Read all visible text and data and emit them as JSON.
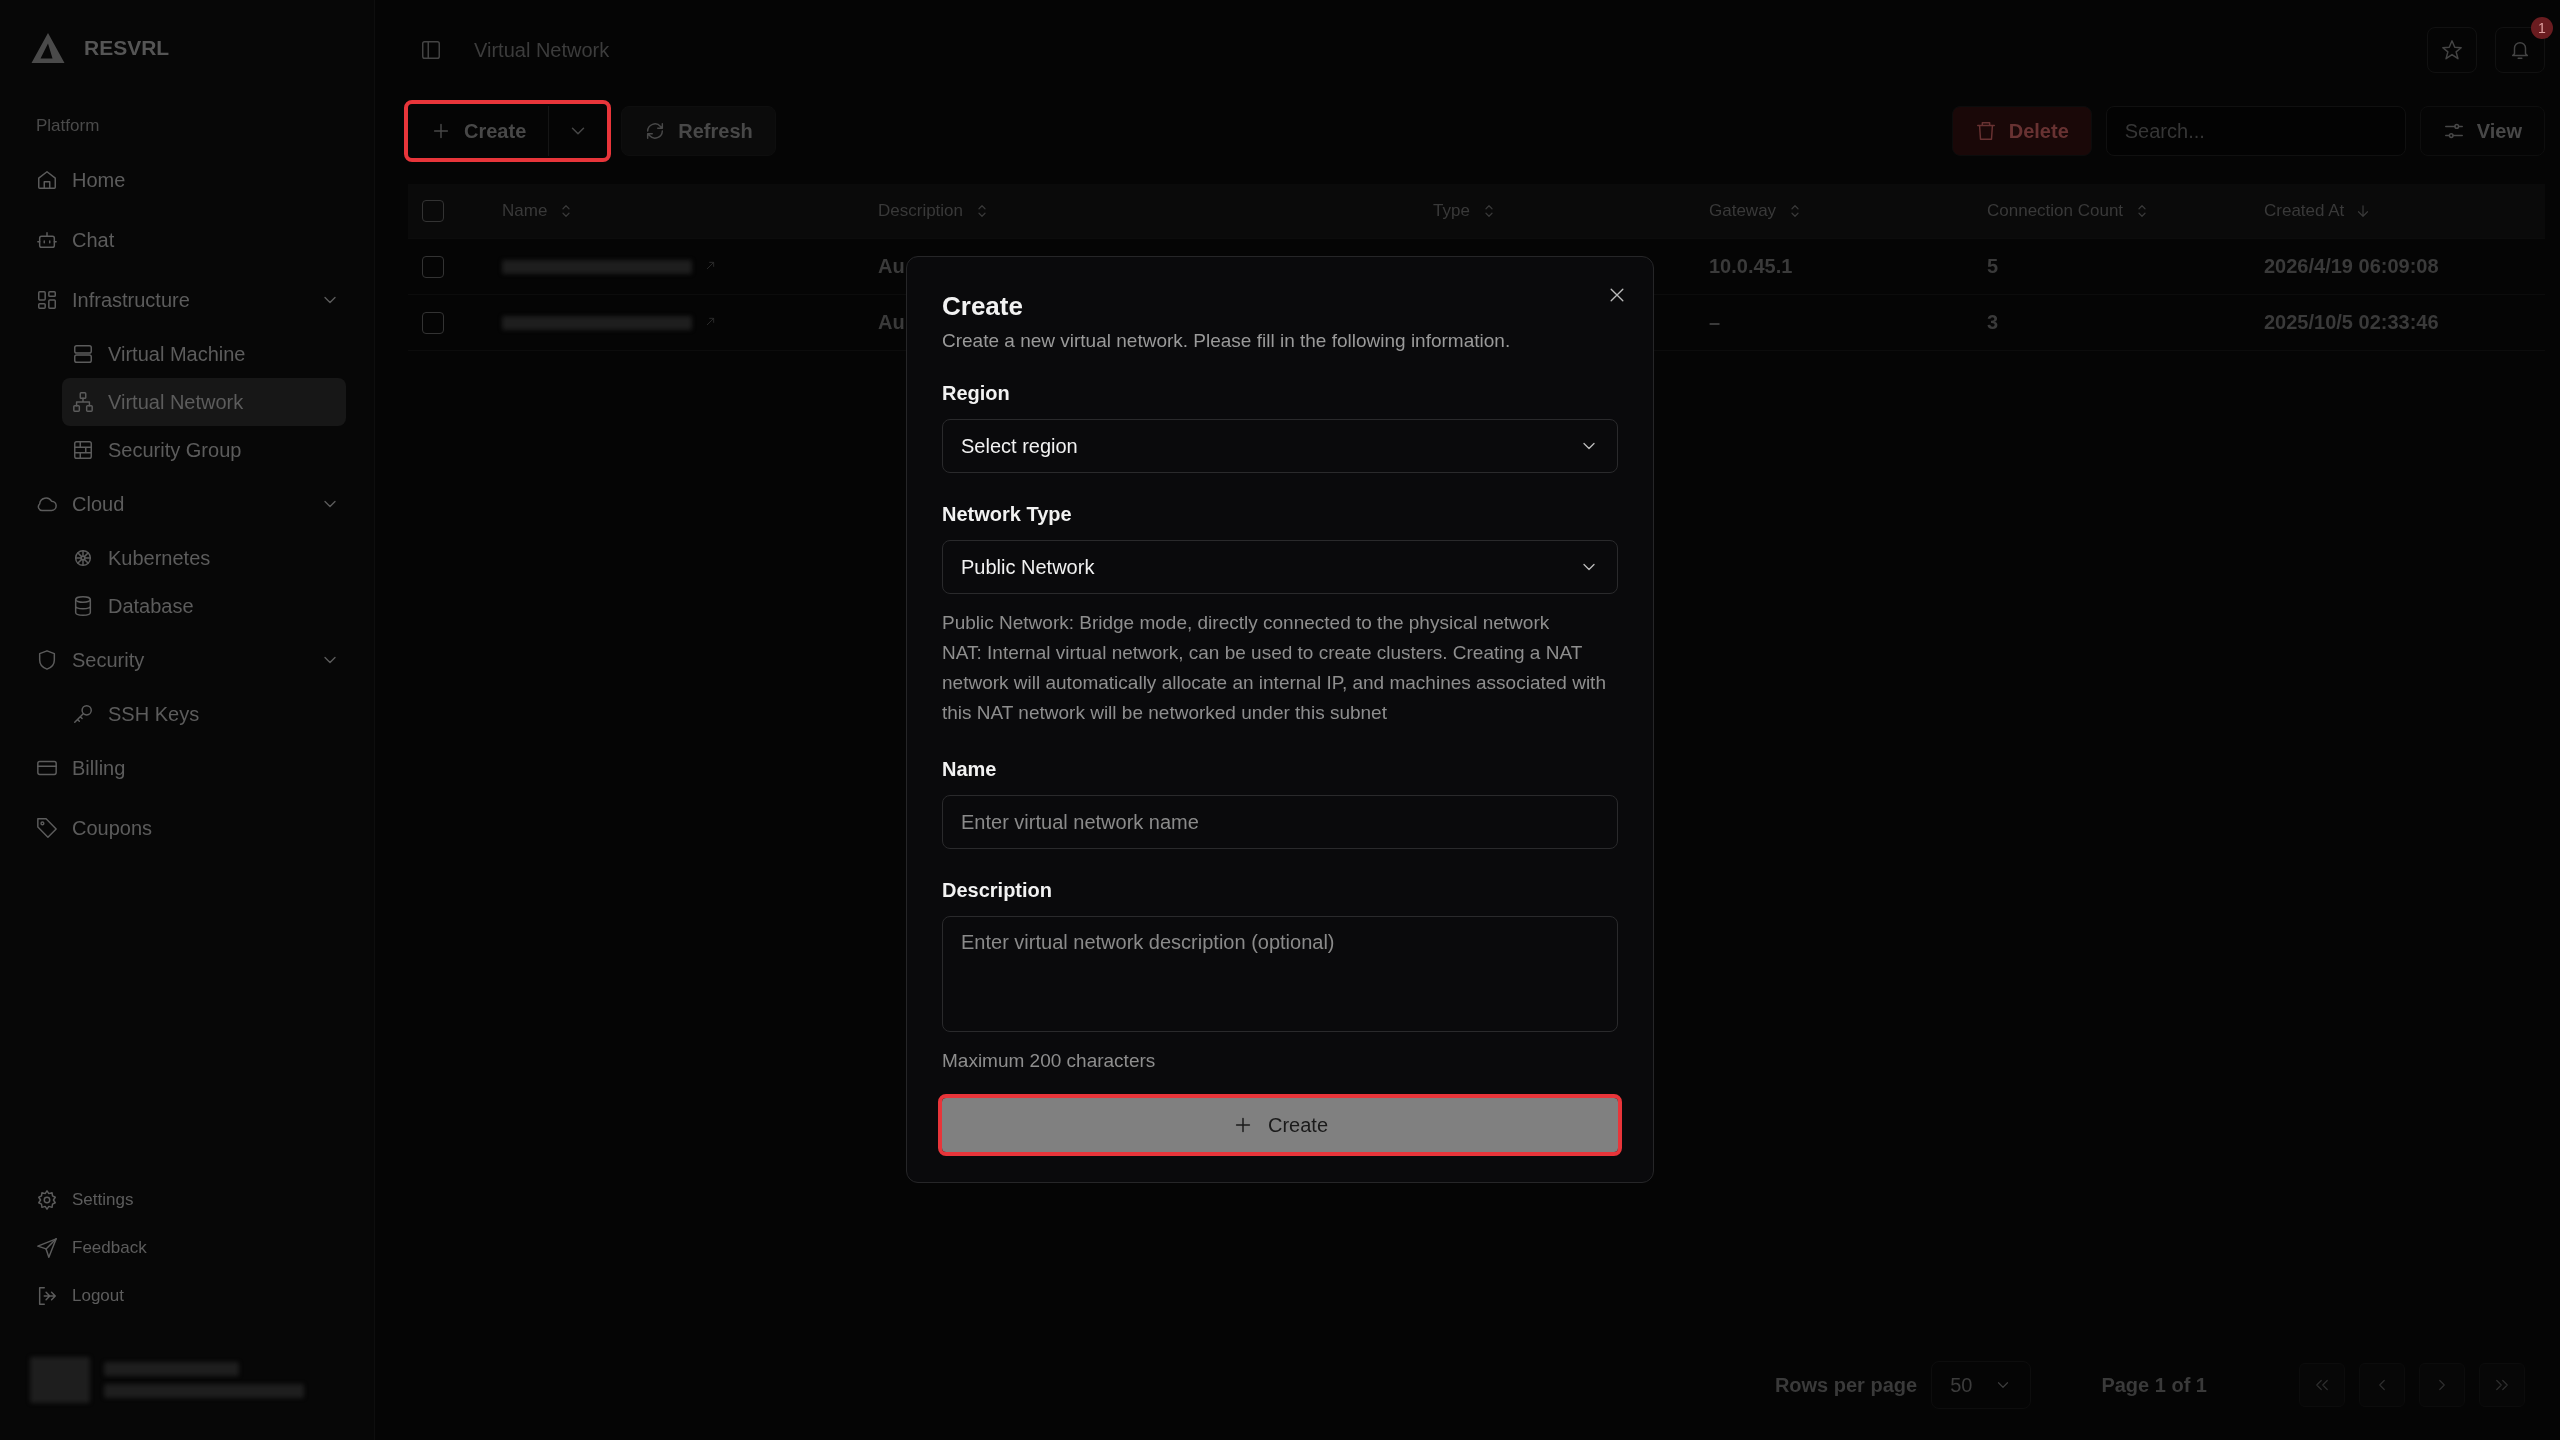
{
  "sidebar": {
    "logo": "RESVRL",
    "section_label": "Platform",
    "items": [
      {
        "label": "Home",
        "selected": false
      },
      {
        "label": "Chat",
        "selected": false
      },
      {
        "label": "Infrastructure",
        "selected": false,
        "expanded": true,
        "children": [
          {
            "label": "Virtual Machine",
            "selected": false
          },
          {
            "label": "Virtual Network",
            "selected": true
          },
          {
            "label": "Security Group",
            "selected": false
          }
        ]
      },
      {
        "label": "Cloud",
        "selected": false,
        "expanded": true,
        "children": [
          {
            "label": "Kubernetes",
            "selected": false
          },
          {
            "label": "Database",
            "selected": false
          }
        ]
      },
      {
        "label": "Security",
        "selected": false,
        "expanded": true,
        "children": [
          {
            "label": "SSH Keys",
            "selected": false
          }
        ]
      },
      {
        "label": "Billing",
        "selected": false
      },
      {
        "label": "Coupons",
        "selected": false
      }
    ],
    "footer_items": [
      {
        "label": "Settings"
      },
      {
        "label": "Feedback"
      },
      {
        "label": "Logout"
      }
    ],
    "user": {
      "redacted": true
    }
  },
  "header": {
    "breadcrumb": "Virtual Network",
    "notification_count": "1"
  },
  "toolbar": {
    "left": [
      {
        "kind": "split",
        "label": "Create",
        "highlighted": true
      },
      {
        "kind": "refresh",
        "label": "Refresh",
        "highlighted": false
      }
    ],
    "right": [
      {
        "kind": "delete",
        "label": "Delete",
        "disabled": true
      },
      {
        "kind": "search",
        "placeholder": "Search..."
      },
      {
        "kind": "view",
        "label": "View"
      }
    ]
  },
  "table": {
    "all_checked": false,
    "columns": [
      {
        "label": "Name",
        "sorted": false
      },
      {
        "label": "Description",
        "sorted": false
      },
      {
        "label": "Type",
        "sorted": false
      },
      {
        "label": "Gateway",
        "sorted": false
      },
      {
        "label": "Connection Count",
        "sorted": false
      },
      {
        "label": "Created At",
        "sorted": true
      }
    ],
    "rows": [
      {
        "checked": false,
        "name_redacted": true,
        "description": "Au",
        "gateway": "10.0.45.1",
        "connection_count": "5",
        "created_at": "2026/4/19 06:09:08"
      },
      {
        "checked": false,
        "name_redacted": true,
        "description": "Au",
        "gateway": "–",
        "connection_count": "3",
        "created_at": "2025/10/5 02:33:46"
      }
    ]
  },
  "pagination": {
    "rows_per_page_label": "Rows per page",
    "rows_per_page": "50",
    "page_label": "Page 1 of 1"
  },
  "dialog": {
    "title": "Create",
    "subtitle": "Create a new virtual network. Please fill in the following information.",
    "fields": [
      {
        "kind": "select",
        "label": "Region",
        "value": "Select region"
      },
      {
        "kind": "select",
        "label": "Network Type",
        "value": "Public Network",
        "help": [
          "Public Network: Bridge mode, directly connected to the physical network",
          "NAT: Internal virtual network, can be used to create clusters. Creating a NAT network will automatically allocate an internal IP, and machines associated with this NAT network will be networked under this subnet"
        ]
      },
      {
        "kind": "input",
        "label": "Name",
        "placeholder": "Enter virtual network name"
      },
      {
        "kind": "textarea",
        "label": "Description",
        "placeholder": "Enter virtual network description (optional)",
        "help": [
          "Maximum 200 characters"
        ]
      }
    ],
    "submit": {
      "label": "Create",
      "highlighted": true
    }
  }
}
